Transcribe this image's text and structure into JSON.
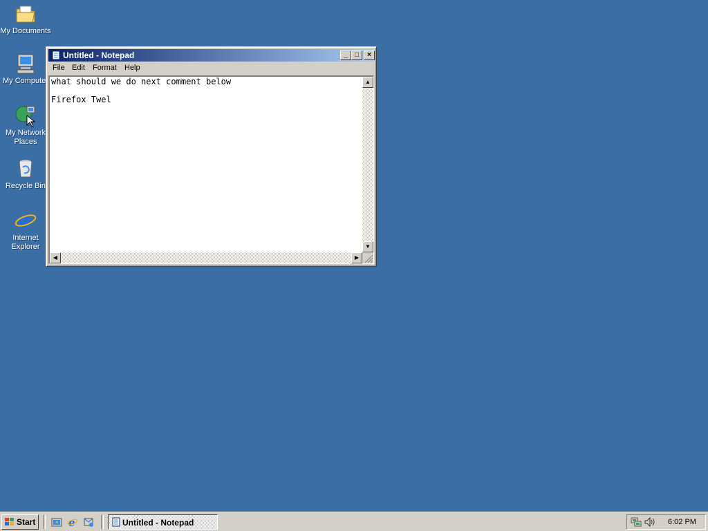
{
  "desktop": {
    "icons": [
      {
        "label": "My Documents"
      },
      {
        "label": "My Computer"
      },
      {
        "label": "My Network Places"
      },
      {
        "label": "Recycle Bin"
      },
      {
        "label": "Internet Explorer"
      }
    ],
    "background_color": "#3a6ea5"
  },
  "window": {
    "title": "Untitled - Notepad",
    "menu": [
      "File",
      "Edit",
      "Format",
      "Help"
    ],
    "content": "what should we do next comment below\n\nFirefox Twel",
    "buttons": {
      "minimize": "_",
      "maximize": "□",
      "close": "×"
    }
  },
  "taskbar": {
    "start_label": "Start",
    "quick_launch": [
      "show-desktop-icon",
      "internet-explorer-icon",
      "outlook-express-icon"
    ],
    "task_button_label": "Untitled - Notepad",
    "clock": "6:02 PM"
  }
}
